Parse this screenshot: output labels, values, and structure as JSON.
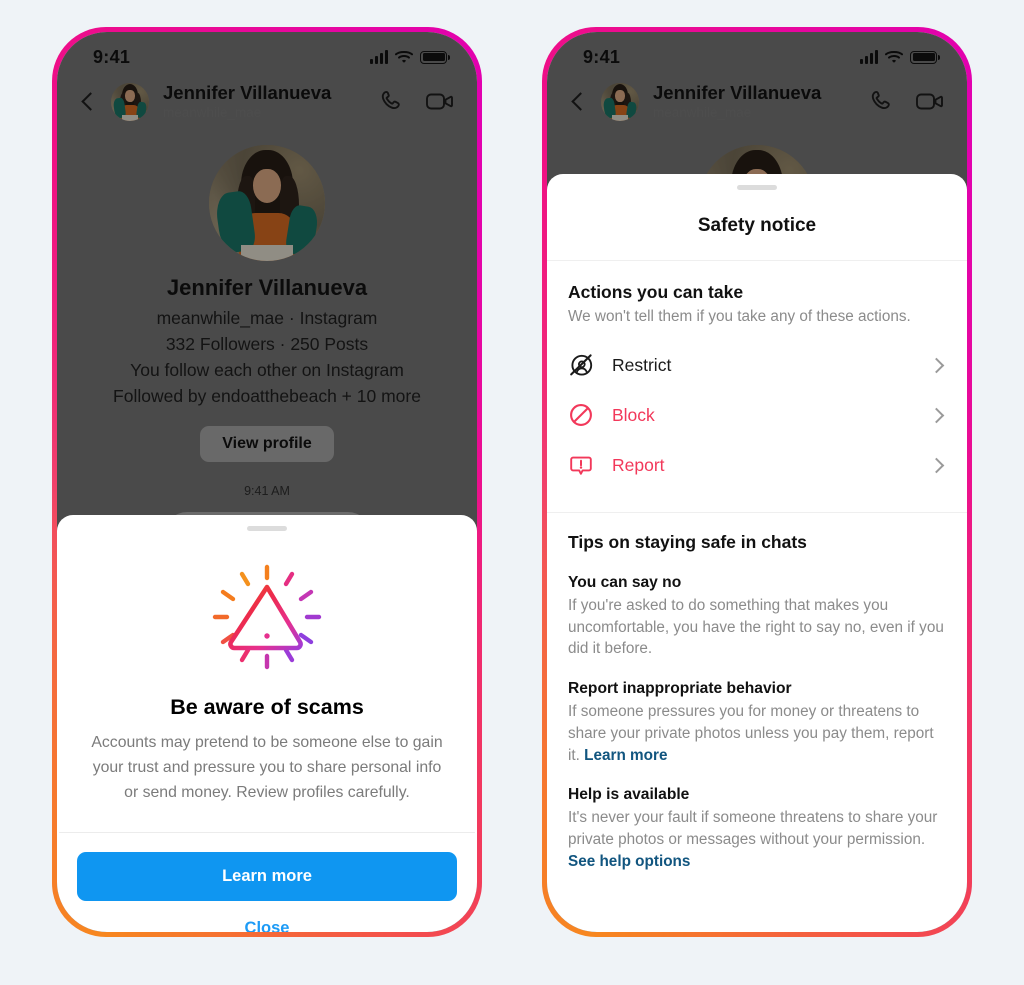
{
  "theme": {
    "page_bg": "#EFF3F7",
    "frame_gradient_orange": "#F7871F",
    "frame_gradient_pink": "#F1406B",
    "frame_gradient_magenta": "#E100B0",
    "primary_button": "#0F96F1",
    "link_blue": "#1D9BF6",
    "danger_red": "#F2385A",
    "tip_link": "#11557F"
  },
  "status_bar": {
    "time": "9:41",
    "signal_icon": "signal-bars-icon",
    "wifi_icon": "wifi-icon",
    "battery_icon": "battery-full-icon"
  },
  "chat_header": {
    "back_icon": "back-chevron-icon",
    "avatar": "contact-avatar",
    "name": "Jennifer Villanueva",
    "handle": "meanwhile_mae",
    "call_icon": "phone-call-icon",
    "video_icon": "video-call-icon"
  },
  "profile": {
    "avatar": "profile-avatar",
    "name": "Jennifer Villanueva",
    "subtitle": "meanwhile_mae · Instagram",
    "stats": "332 Followers · 250 Posts",
    "mutual": "You follow each other on Instagram",
    "followed_by": "Followed by endoatthebeach + 10 more",
    "view_profile_label": "View profile",
    "message_time": "9:41 AM"
  },
  "scam_dialog": {
    "icon": "warning-triangle-burst-icon",
    "title": "Be aware of scams",
    "description": "Accounts may pretend to be someone else to gain your trust and pressure you to share personal info or send money. Review profiles carefully.",
    "primary_label": "Learn more",
    "secondary_label": "Close"
  },
  "safety_notice": {
    "title": "Safety notice",
    "actions_section": {
      "heading": "Actions you can take",
      "subtext": "We won't tell them if you take any of these actions.",
      "items": [
        {
          "label": "Restrict",
          "icon": "restrict-icon",
          "tone": "dark"
        },
        {
          "label": "Block",
          "icon": "block-icon",
          "tone": "danger"
        },
        {
          "label": "Report",
          "icon": "report-icon",
          "tone": "danger"
        }
      ]
    },
    "tips_section": {
      "heading": "Tips on staying safe in chats",
      "tips": [
        {
          "title": "You can say no",
          "body": "If you're asked to do something that makes you uncomfortable, you have the right to say no, even if you did it before.",
          "link": ""
        },
        {
          "title": "Report inappropriate behavior",
          "body": "If someone pressures you for money or threatens to share your private photos unless you pay them, report it. ",
          "link": "Learn more"
        },
        {
          "title": "Help is available",
          "body": "It's never your fault if someone threatens to share your private photos or messages without your permission. ",
          "link": "See help options"
        }
      ]
    }
  }
}
